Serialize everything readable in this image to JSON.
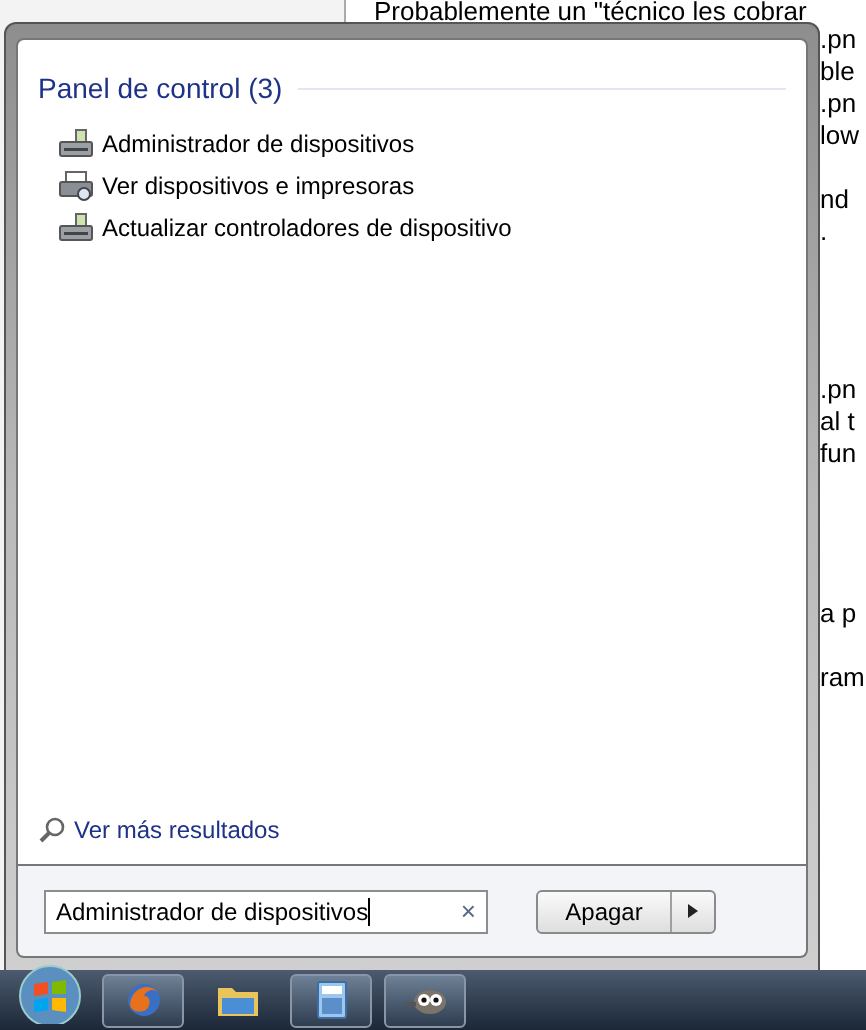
{
  "document": {
    "first_line": "Probablemente un \"técnico les cobrar",
    "fragments": [
      ".pn",
      "ble",
      ".pn",
      "low",
      "nd",
      ".",
      ".pn",
      "al t",
      "fun",
      "a p",
      "ram"
    ]
  },
  "start_menu": {
    "group_title": "Panel de control (3)",
    "results": [
      {
        "label": "Administrador de dispositivos",
        "kind": "device"
      },
      {
        "label": "Ver dispositivos e impresoras",
        "kind": "printer"
      },
      {
        "label": "Actualizar controladores de dispositivo",
        "kind": "device"
      }
    ],
    "more_results": "Ver más resultados",
    "search": {
      "value": "Administrador de dispositivos",
      "clear": "×"
    },
    "shutdown_button": "Apagar"
  },
  "taskbar": {
    "items": [
      {
        "kind": "firefox",
        "running": true
      },
      {
        "kind": "folder",
        "running": false
      },
      {
        "kind": "calculator",
        "running": true
      },
      {
        "kind": "gimp",
        "running": true
      }
    ]
  }
}
